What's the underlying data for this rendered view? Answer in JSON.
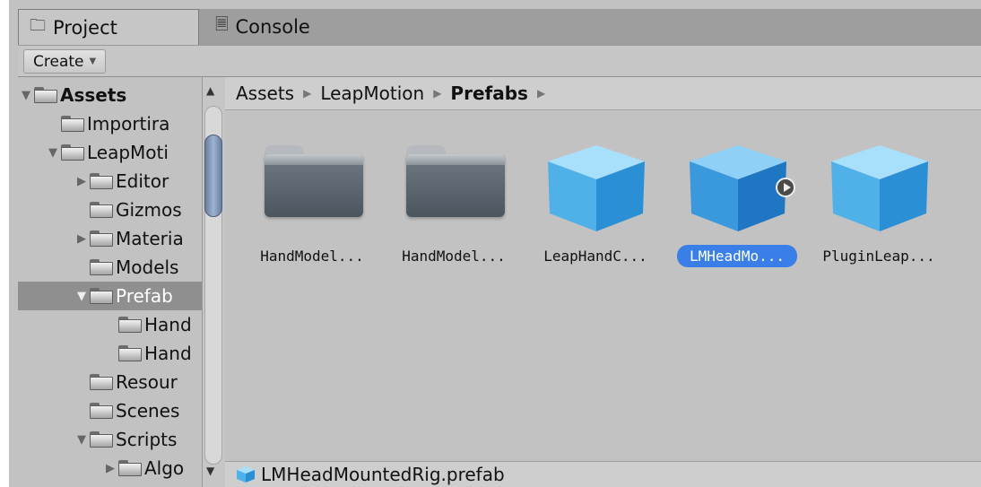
{
  "tabs": {
    "project": {
      "label": "Project",
      "icon": "folder-icon"
    },
    "console": {
      "label": "Console",
      "icon": "console-icon"
    }
  },
  "toolbar": {
    "create_label": "Create"
  },
  "tree": {
    "items": [
      {
        "label": "Assets",
        "expanded": true,
        "bold": true
      },
      {
        "label": "Importira"
      },
      {
        "label": "LeapMoti",
        "expanded": true
      },
      {
        "label": "Editor",
        "expanded": false
      },
      {
        "label": "Gizmos"
      },
      {
        "label": "Materia",
        "expanded": false
      },
      {
        "label": "Models"
      },
      {
        "label": "Prefab",
        "expanded": true,
        "selected": true
      },
      {
        "label": "Hand"
      },
      {
        "label": "Hand"
      },
      {
        "label": "Resour"
      },
      {
        "label": "Scenes"
      },
      {
        "label": "Scripts",
        "expanded": true
      },
      {
        "label": "Algo",
        "expanded": false
      }
    ]
  },
  "breadcrumb": {
    "items": [
      "Assets",
      "LeapMotion",
      "Prefabs"
    ]
  },
  "assets": [
    {
      "label": "HandModel...",
      "kind": "folder"
    },
    {
      "label": "HandModel...",
      "kind": "folder"
    },
    {
      "label": "LeapHandC...",
      "kind": "prefab"
    },
    {
      "label": "LMHeadMo...",
      "kind": "prefab",
      "selected": true
    },
    {
      "label": "PluginLeap...",
      "kind": "prefab"
    }
  ],
  "footer": {
    "selected_path": "LMHeadMountedRig.prefab"
  },
  "colors": {
    "selection": "#3a7fe8",
    "cube_light": "#8fd3f6",
    "cube_dark": "#1f7fc9"
  }
}
